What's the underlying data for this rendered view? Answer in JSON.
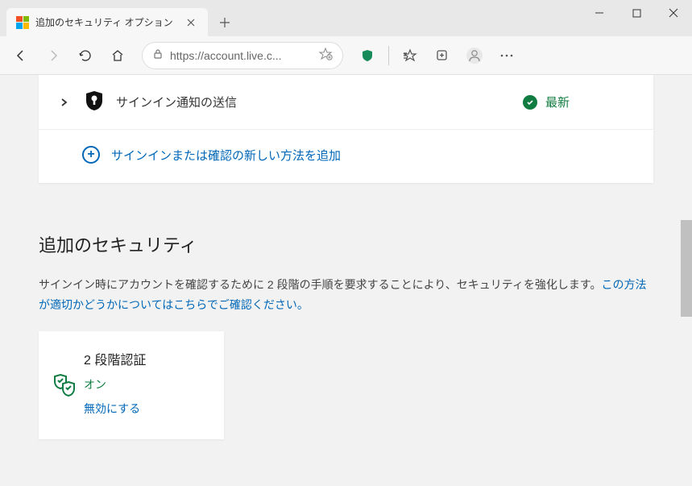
{
  "tab": {
    "title": "追加のセキュリティ オプション"
  },
  "address": {
    "url": "https://account.live.c..."
  },
  "signin_row": {
    "label": "サインイン通知の送信",
    "status": "最新"
  },
  "add_method": {
    "label": "サインインまたは確認の新しい方法を追加"
  },
  "section": {
    "title": "追加のセキュリティ",
    "desc_pre": "サインイン時にアカウントを確認するために 2 段階の手順を要求することにより、セキュリティを強化します。",
    "desc_link": "この方法が適切かどうかについてはこちらでご確認ください。"
  },
  "twostep": {
    "title": "2 段階認証",
    "status": "オン",
    "disable": "無効にする"
  }
}
